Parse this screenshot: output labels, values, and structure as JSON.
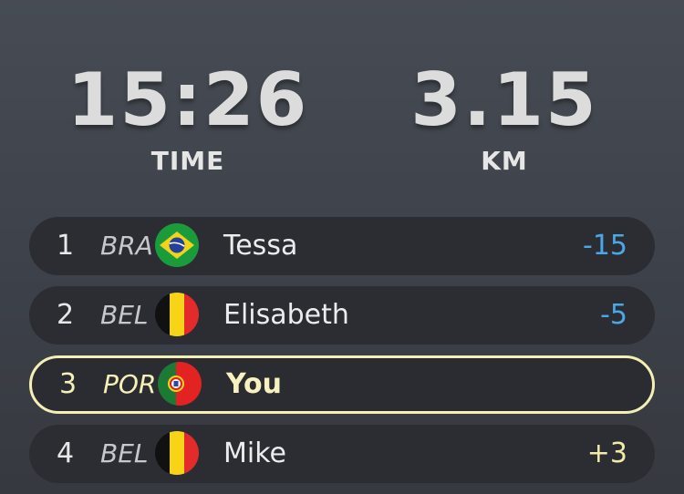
{
  "stats": {
    "time": {
      "value": "15:26",
      "label": "TIME"
    },
    "distance": {
      "value": "3.15",
      "label": "KM"
    }
  },
  "leaderboard": [
    {
      "rank": "1",
      "country": "BRA",
      "flag": "brazil-flag-icon",
      "name": "Tessa",
      "delta": "-15",
      "delta_color": "#4aa8e8"
    },
    {
      "rank": "2",
      "country": "BEL",
      "flag": "belgium-flag-icon",
      "name": "Elisabeth",
      "delta": "-5",
      "delta_color": "#4aa8e8"
    },
    {
      "rank": "3",
      "country": "POR",
      "flag": "portugal-flag-icon",
      "name": "You",
      "delta": "",
      "delta_color": ""
    },
    {
      "rank": "4",
      "country": "BEL",
      "flag": "belgium-flag-icon",
      "name": "Mike",
      "delta": "+3",
      "delta_color": "#f1eba6"
    }
  ],
  "colors": {
    "highlight_border": "#f4efb4",
    "ahead_delta": "#4aa8e8",
    "behind_delta": "#f1eba6"
  }
}
